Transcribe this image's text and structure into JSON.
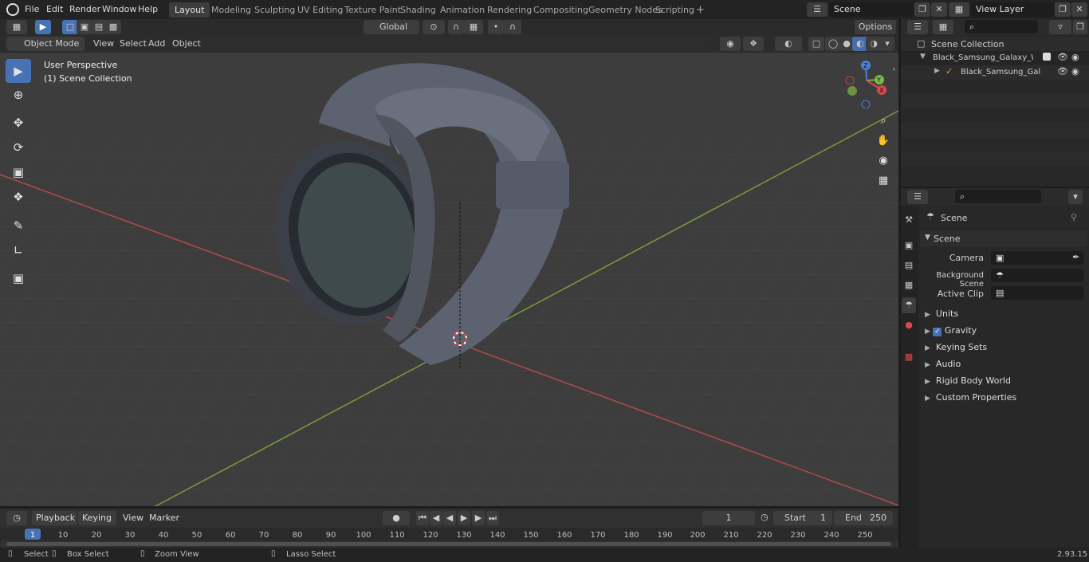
{
  "topbar": {
    "menus": [
      "File",
      "Edit",
      "Render",
      "Window",
      "Help"
    ],
    "workspaces": [
      "Layout",
      "Modeling",
      "Sculpting",
      "UV Editing",
      "Texture Paint",
      "Shading",
      "Animation",
      "Rendering",
      "Compositing",
      "Geometry Nodes",
      "Scripting"
    ],
    "active_workspace": "Layout",
    "add_tab": "+",
    "scene": "Scene",
    "view_layer": "View Layer"
  },
  "viewport": {
    "mode": "Object Mode",
    "menus": [
      "View",
      "Select",
      "Add",
      "Object"
    ],
    "orientation": "Global",
    "options": "Options",
    "overlay_title": "User Perspective",
    "overlay_sub": "(1) Scene Collection",
    "gizmo": {
      "z": "Z",
      "y": "Y",
      "x": "X"
    }
  },
  "outliner": {
    "search_placeholder": "",
    "root": "Scene Collection",
    "items": [
      "Black_Samsung_Galaxy_Watc",
      "Black_Samsung_Galaxy_"
    ]
  },
  "properties": {
    "header": "Scene",
    "panel": "Scene",
    "fields": [
      {
        "label": "Camera"
      },
      {
        "label": "Background Scene"
      },
      {
        "label": "Active Clip"
      }
    ],
    "sections": [
      "Units",
      "Gravity",
      "Keying Sets",
      "Audio",
      "Rigid Body World",
      "Custom Properties"
    ]
  },
  "timeline": {
    "menus": [
      "Playback",
      "Keying",
      "View",
      "Marker"
    ],
    "current_frame": "1",
    "start_label": "Start",
    "start": "1",
    "end_label": "End",
    "end": "250",
    "ticks": [
      "1",
      "10",
      "20",
      "30",
      "40",
      "50",
      "60",
      "70",
      "80",
      "90",
      "100",
      "110",
      "120",
      "130",
      "140",
      "150",
      "160",
      "170",
      "180",
      "190",
      "200",
      "210",
      "220",
      "230",
      "240",
      "250"
    ]
  },
  "statusbar": {
    "select": "Select",
    "box_select": "Box Select",
    "zoom": "Zoom View",
    "lasso": "Lasso Select",
    "version": "2.93.15"
  },
  "colors": {
    "accent": "#4772b3",
    "x_axis": "#b34b4b",
    "y_axis": "#7a9c3a"
  }
}
